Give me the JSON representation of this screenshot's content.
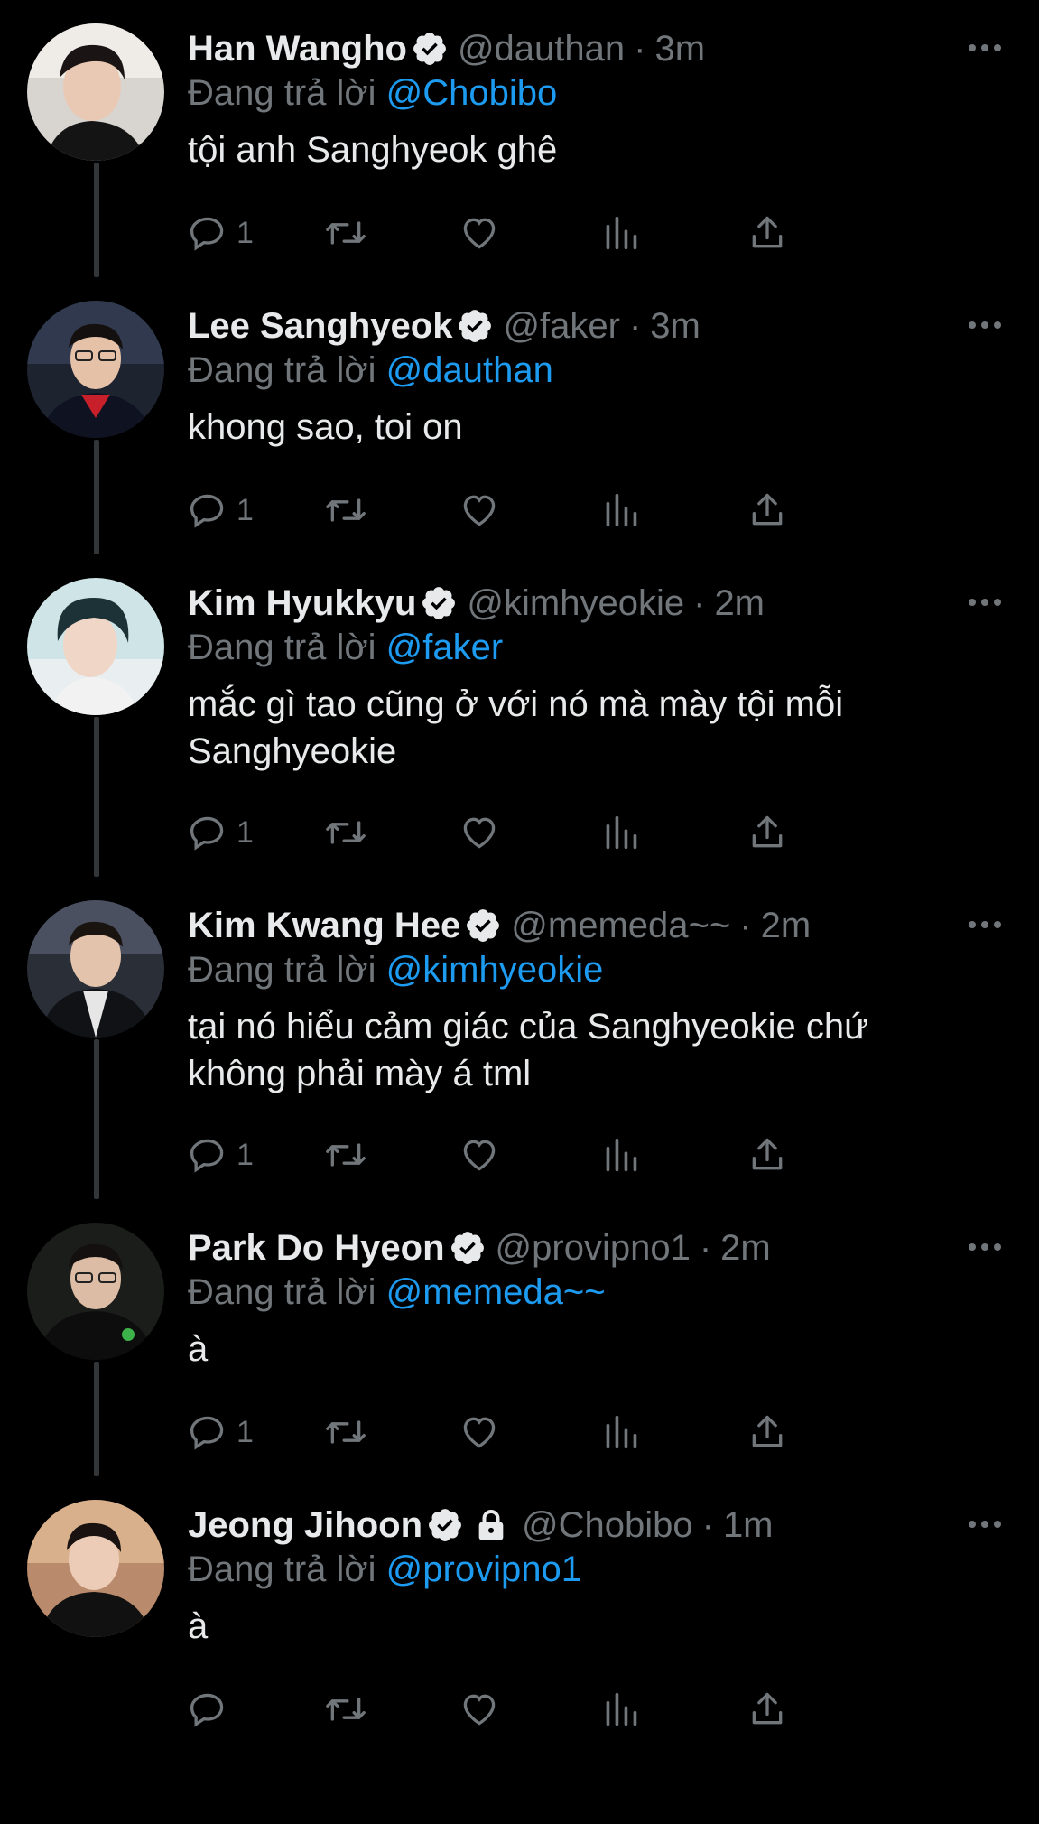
{
  "reply_prefix": "Đang trả lời",
  "tweets": [
    {
      "name": "Han Wangho",
      "handle": "@dauthan",
      "time": "3m",
      "reply_to": "@Chobibo",
      "text": "tội anh Sanghyeok ghê",
      "reply_count": "1",
      "locked": false
    },
    {
      "name": "Lee Sanghyeok",
      "handle": "@faker",
      "time": "3m",
      "reply_to": "@dauthan",
      "text": "khong sao, toi on",
      "reply_count": "1",
      "locked": false
    },
    {
      "name": "Kim Hyukkyu",
      "handle": "@kimhyeokie",
      "time": "2m",
      "reply_to": "@faker",
      "text": "mắc gì tao cũng ở với nó mà mày tội mỗi Sanghyeokie",
      "reply_count": "1",
      "locked": false
    },
    {
      "name": "Kim Kwang Hee",
      "handle": "@memeda~~",
      "time": "2m",
      "reply_to": "@kimhyeokie",
      "text": "tại nó hiểu cảm giác của Sanghyeokie chứ không phải mày á tml",
      "reply_count": "1",
      "locked": false
    },
    {
      "name": "Park Do Hyeon",
      "handle": "@provipno1",
      "time": "2m",
      "reply_to": "@memeda~~",
      "text": "à",
      "reply_count": "1",
      "locked": false
    },
    {
      "name": "Jeong Jihoon",
      "handle": "@Chobibo",
      "time": "1m",
      "reply_to": "@provipno1",
      "text": "à",
      "reply_count": "",
      "locked": true
    }
  ],
  "icons": {
    "reply": "speech-bubble-icon",
    "retweet": "retweet-arrows-icon",
    "like": "heart-outline-icon",
    "views": "bar-chart-icon",
    "share": "share-upload-icon",
    "verified": "verified-badge-icon",
    "lock": "lock-icon",
    "more": "three-dots-icon"
  },
  "colors": {
    "background": "#000000",
    "text": "#e7e9ea",
    "secondary": "#71767b",
    "link": "#1d9bf0",
    "thread_line": "#333639"
  }
}
